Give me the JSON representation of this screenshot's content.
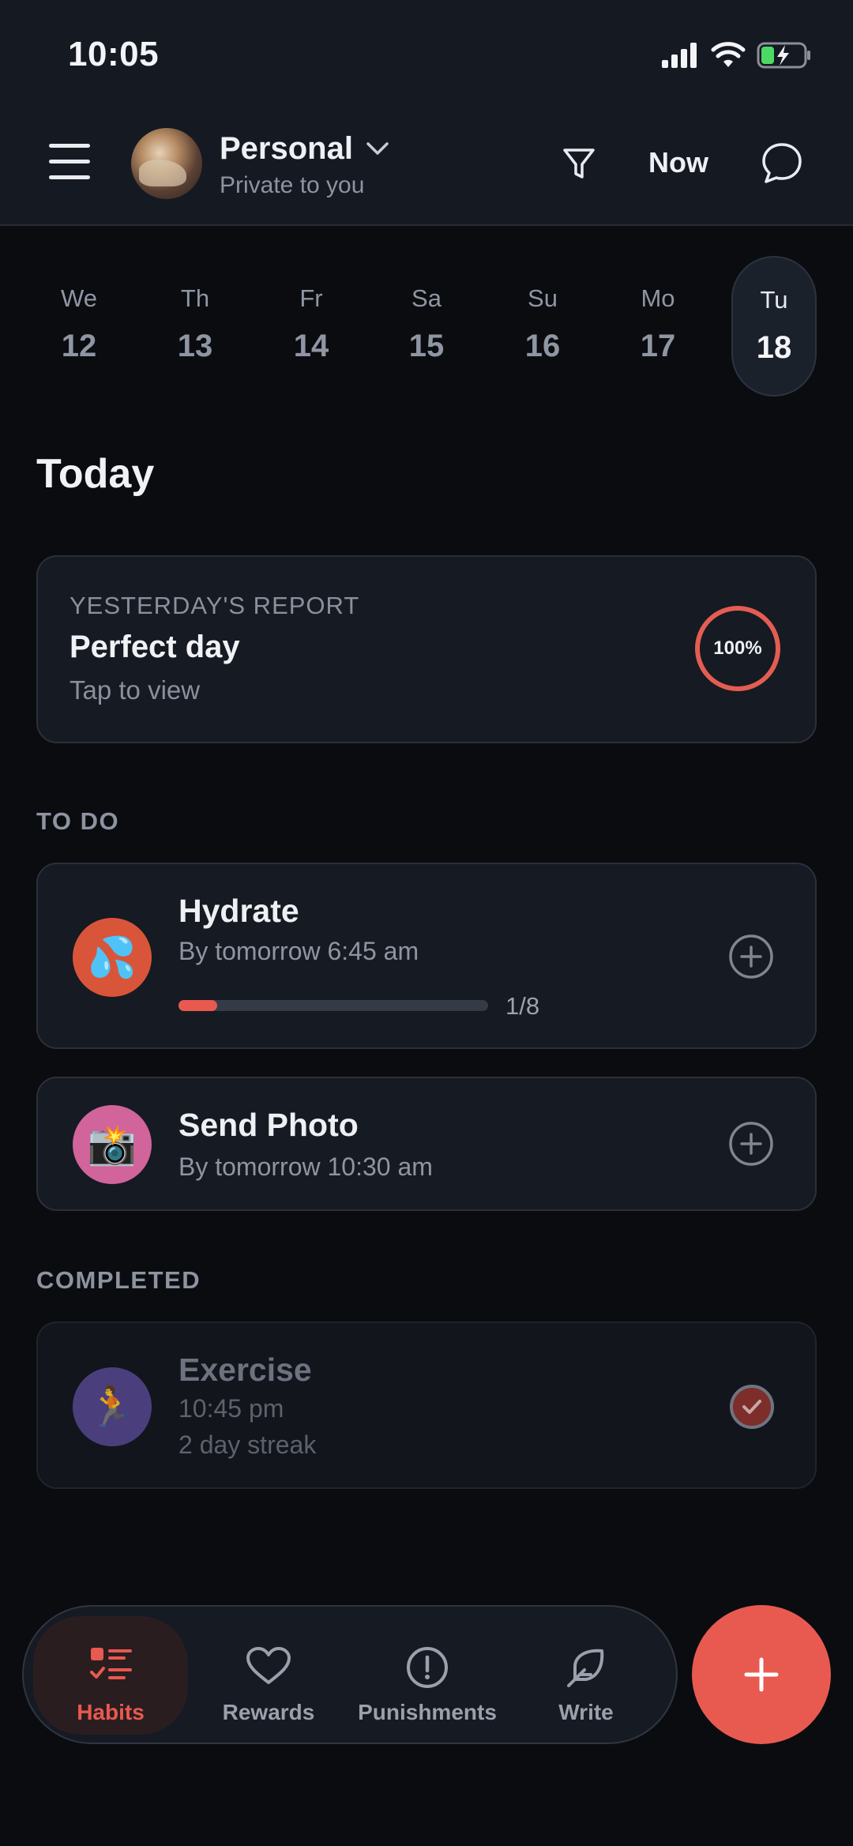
{
  "status_bar": {
    "time": "10:05"
  },
  "header": {
    "workspace_name": "Personal",
    "workspace_subtitle": "Private to you",
    "now_label": "Now"
  },
  "days": [
    {
      "abbr": "We",
      "num": "12",
      "selected": false
    },
    {
      "abbr": "Th",
      "num": "13",
      "selected": false
    },
    {
      "abbr": "Fr",
      "num": "14",
      "selected": false
    },
    {
      "abbr": "Sa",
      "num": "15",
      "selected": false
    },
    {
      "abbr": "Su",
      "num": "16",
      "selected": false
    },
    {
      "abbr": "Mo",
      "num": "17",
      "selected": false
    },
    {
      "abbr": "Tu",
      "num": "18",
      "selected": true
    }
  ],
  "today_title": "Today",
  "report": {
    "label": "YESTERDAY'S REPORT",
    "title": "Perfect day",
    "subtitle": "Tap to view",
    "percent": "100%"
  },
  "todo": {
    "label": "TO DO",
    "items": [
      {
        "icon": "💦",
        "name": "Hydrate",
        "due": "By tomorrow 6:45 am",
        "progress": "1/8",
        "progress_fraction": 0.125,
        "icon_bg": "#d9553a"
      },
      {
        "icon": "📸",
        "name": "Send Photo",
        "due": "By tomorrow 10:30 am",
        "icon_bg": "#d0649b"
      }
    ]
  },
  "completed": {
    "label": "COMPLETED",
    "items": [
      {
        "icon": "🏃",
        "name": "Exercise",
        "time": "10:45 pm",
        "streak": "2 day streak",
        "icon_bg": "#56468e"
      }
    ]
  },
  "nav": {
    "items": [
      {
        "label": "Habits",
        "icon": "habits-icon",
        "active": true
      },
      {
        "label": "Rewards",
        "icon": "heart-icon",
        "active": false
      },
      {
        "label": "Punishments",
        "icon": "alert-icon",
        "active": false
      },
      {
        "label": "Write",
        "icon": "feather-icon",
        "active": false
      }
    ]
  },
  "colors": {
    "accent": "#e85a50",
    "background": "#0b0c10",
    "card": "#161a22"
  }
}
